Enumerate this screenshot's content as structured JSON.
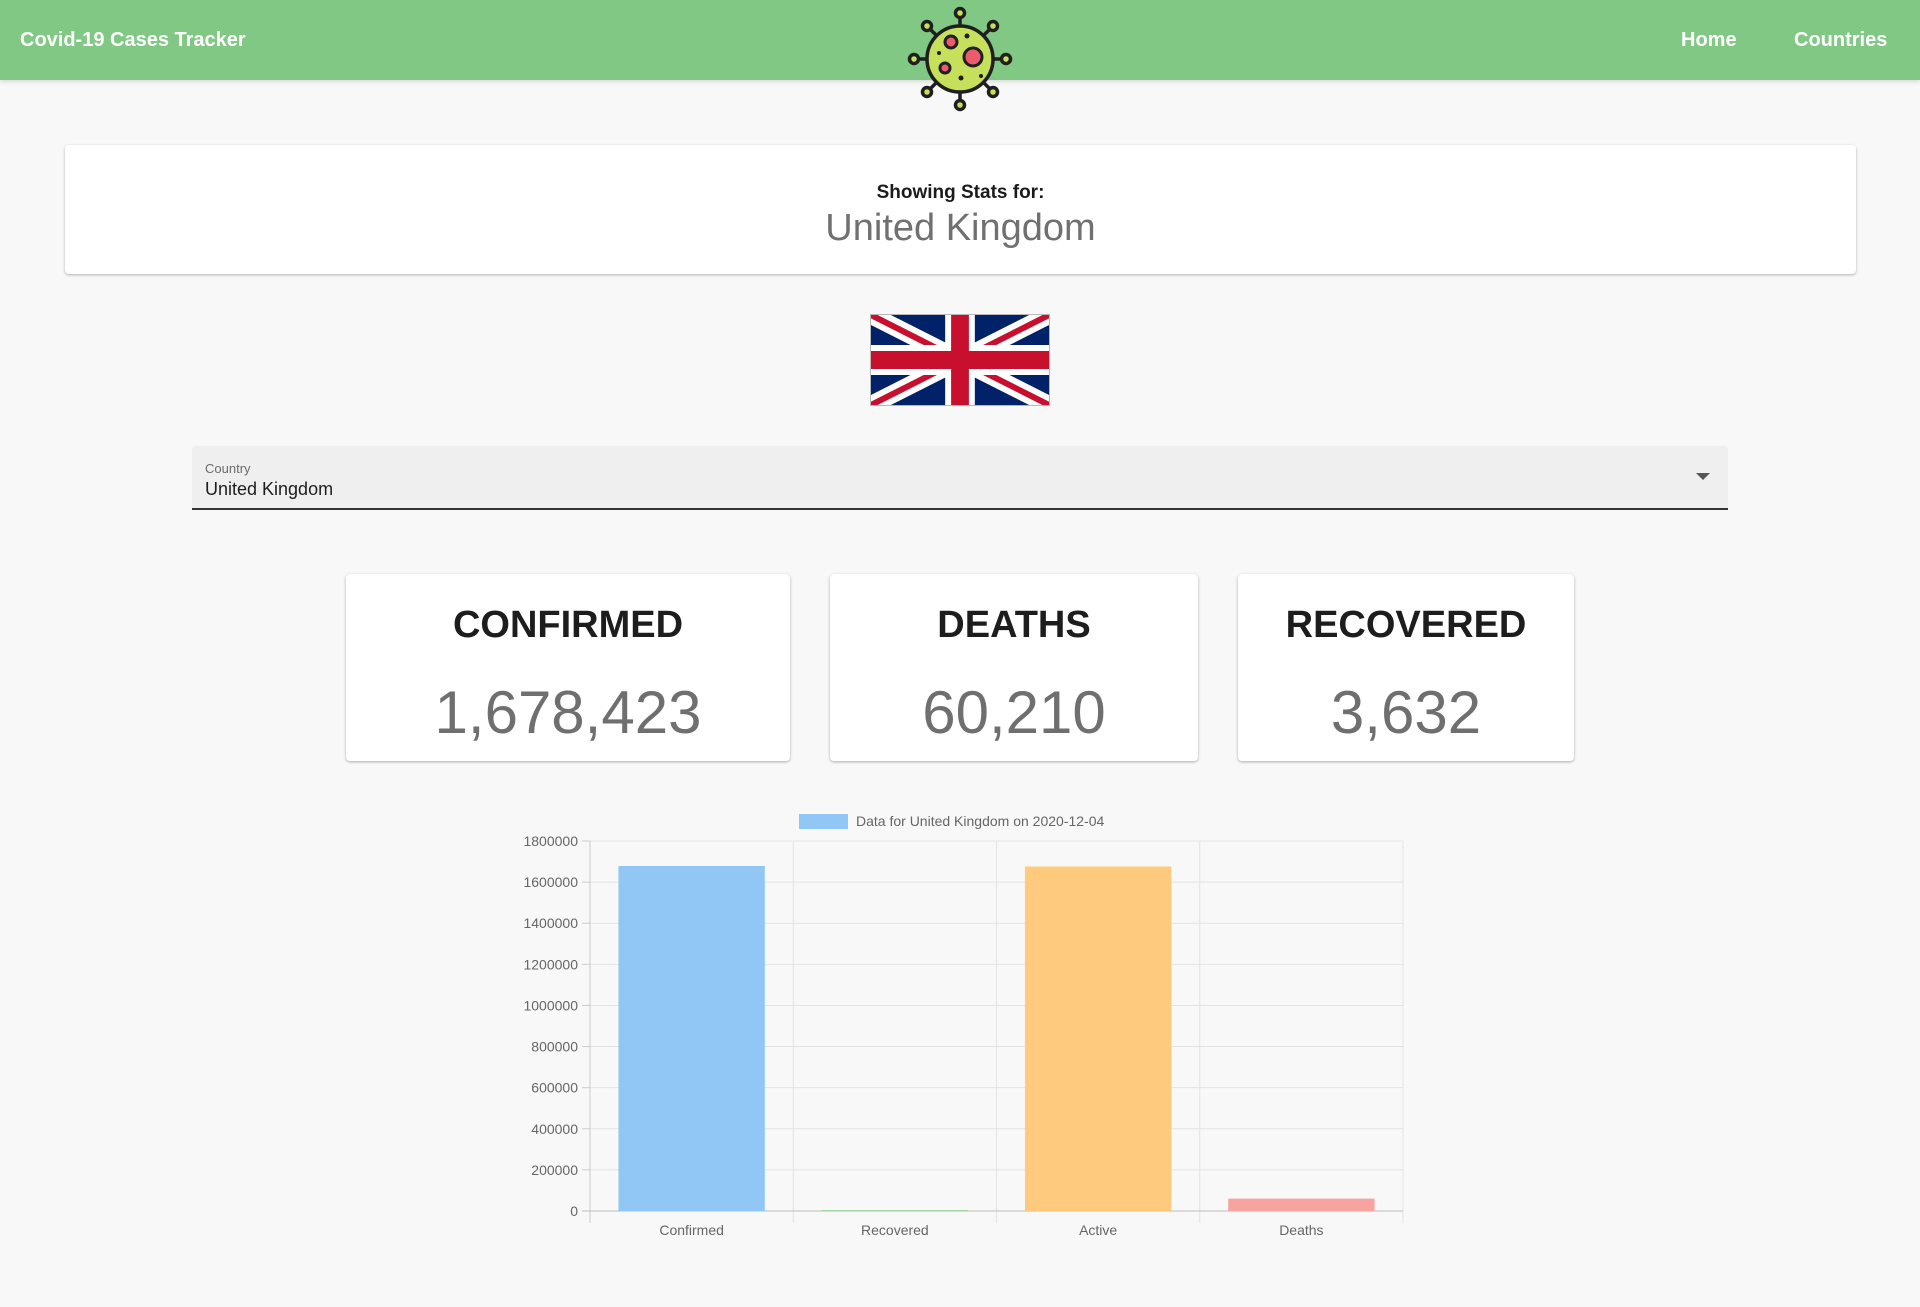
{
  "header": {
    "brand": "Covid-19 Cases Tracker",
    "logo_icon": "virus-icon",
    "nav": {
      "home": "Home",
      "countries": "Countries"
    },
    "color": "#81c884"
  },
  "stats_header": {
    "label": "Showing Stats for:",
    "country": "United Kingdom"
  },
  "flag": {
    "icon": "uk-flag-icon"
  },
  "country_select": {
    "label": "Country",
    "value": "United Kingdom"
  },
  "stats": {
    "confirmed": {
      "title": "CONFIRMED",
      "value": "1,678,423"
    },
    "deaths": {
      "title": "DEATHS",
      "value": "60,210"
    },
    "recovered": {
      "title": "RECOVERED",
      "value": "3,632"
    }
  },
  "chart_data": {
    "type": "bar",
    "legend": "Data for United Kingdom on 2020-12-04",
    "legend_position": "top",
    "categories": [
      "Confirmed",
      "Recovered",
      "Active",
      "Deaths"
    ],
    "values": [
      1678423,
      3632,
      1676000,
      60210
    ],
    "colors": [
      "#90c7f5",
      "#a5d6a7",
      "#fecb7e",
      "#f7a3a0"
    ],
    "ylim": [
      0,
      1800000
    ],
    "yticks": [
      "1800000",
      "1600000",
      "1400000",
      "1200000",
      "1000000",
      "800000",
      "600000",
      "400000",
      "200000",
      "0"
    ],
    "grid": true
  }
}
